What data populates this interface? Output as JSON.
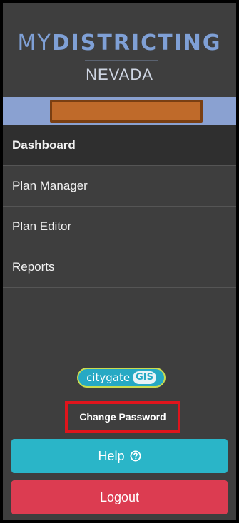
{
  "brand": {
    "prefix": "MY",
    "name": "DISTRICTING",
    "region": "NEVADA"
  },
  "user": {
    "name_redacted": true,
    "redaction_color": "#bf6a2a"
  },
  "nav": {
    "items": [
      {
        "label": "Dashboard",
        "active": true
      },
      {
        "label": "Plan Manager",
        "active": false
      },
      {
        "label": "Plan Editor",
        "active": false
      },
      {
        "label": "Reports",
        "active": false
      }
    ]
  },
  "footer": {
    "vendor_logo": {
      "text": "citygate",
      "badge": "GIS"
    },
    "change_password_label": "Change Password",
    "help_label": "Help",
    "help_icon": "question-circle-icon",
    "logout_label": "Logout"
  },
  "colors": {
    "sidebar_bg": "#3e3e3e",
    "brand_blue": "#7fa0d6",
    "user_band": "#8aa1d1",
    "help_button": "#2ab5c8",
    "logout_button": "#dc3c51",
    "highlight_outline": "#e0141c"
  }
}
